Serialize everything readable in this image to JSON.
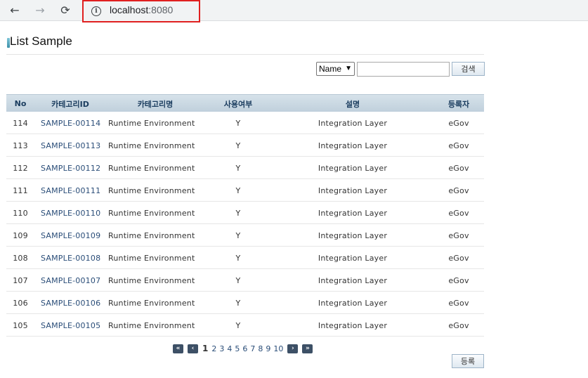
{
  "browser": {
    "back_icon": "←",
    "forward_icon": "→",
    "reload_icon": "⟳",
    "info_icon": "i",
    "url_host": "localhost",
    "url_port": ":8080",
    "highlight_color": "#e02020"
  },
  "page": {
    "title": "List Sample"
  },
  "search": {
    "select_value": "Name",
    "input_value": "",
    "button_label": "검색"
  },
  "table": {
    "headers": {
      "no": "No",
      "category_id": "카테고리ID",
      "category_name": "카테고리명",
      "use_yn": "사용여부",
      "description": "설명",
      "registrant": "등록자"
    },
    "rows": [
      {
        "no": "114",
        "id": "SAMPLE-00114",
        "name": "Runtime Environment",
        "use": "Y",
        "desc": "Integration Layer",
        "reg": "eGov"
      },
      {
        "no": "113",
        "id": "SAMPLE-00113",
        "name": "Runtime Environment",
        "use": "Y",
        "desc": "Integration Layer",
        "reg": "eGov"
      },
      {
        "no": "112",
        "id": "SAMPLE-00112",
        "name": "Runtime Environment",
        "use": "Y",
        "desc": "Integration Layer",
        "reg": "eGov"
      },
      {
        "no": "111",
        "id": "SAMPLE-00111",
        "name": "Runtime Environment",
        "use": "Y",
        "desc": "Integration Layer",
        "reg": "eGov"
      },
      {
        "no": "110",
        "id": "SAMPLE-00110",
        "name": "Runtime Environment",
        "use": "Y",
        "desc": "Integration Layer",
        "reg": "eGov"
      },
      {
        "no": "109",
        "id": "SAMPLE-00109",
        "name": "Runtime Environment",
        "use": "Y",
        "desc": "Integration Layer",
        "reg": "eGov"
      },
      {
        "no": "108",
        "id": "SAMPLE-00108",
        "name": "Runtime Environment",
        "use": "Y",
        "desc": "Integration Layer",
        "reg": "eGov"
      },
      {
        "no": "107",
        "id": "SAMPLE-00107",
        "name": "Runtime Environment",
        "use": "Y",
        "desc": "Integration Layer",
        "reg": "eGov"
      },
      {
        "no": "106",
        "id": "SAMPLE-00106",
        "name": "Runtime Environment",
        "use": "Y",
        "desc": "Integration Layer",
        "reg": "eGov"
      },
      {
        "no": "105",
        "id": "SAMPLE-00105",
        "name": "Runtime Environment",
        "use": "Y",
        "desc": "Integration Layer",
        "reg": "eGov"
      }
    ]
  },
  "pagination": {
    "first_icon": "«",
    "prev_icon": "‹",
    "next_icon": "›",
    "last_icon": "»",
    "current": "1",
    "pages": [
      "2",
      "3",
      "4",
      "5",
      "6",
      "7",
      "8",
      "9",
      "10"
    ]
  },
  "actions": {
    "register_label": "등록"
  }
}
